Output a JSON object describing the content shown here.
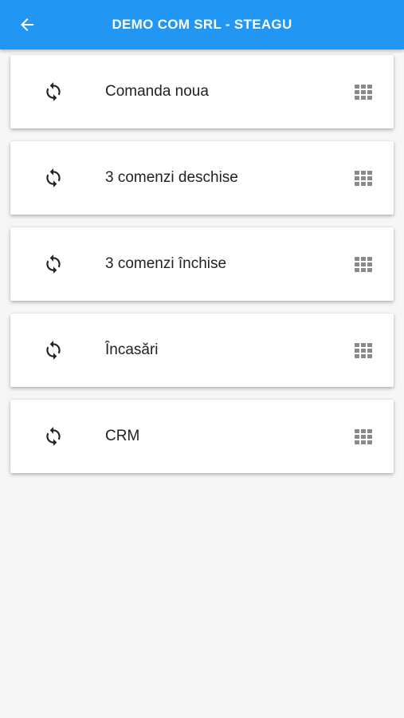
{
  "header": {
    "title": "DEMO COM SRL - STEAGU",
    "back_icon": "arrow-left-icon",
    "background": "#2196f3"
  },
  "menu": {
    "items": [
      {
        "label": "Comanda noua",
        "lead_icon": "sync-icon",
        "trail_icon": "grid-icon"
      },
      {
        "label": "3 comenzi deschise",
        "lead_icon": "sync-icon",
        "trail_icon": "grid-icon"
      },
      {
        "label": "3 comenzi închise",
        "lead_icon": "sync-icon",
        "trail_icon": "grid-icon"
      },
      {
        "label": "Încasări",
        "lead_icon": "sync-icon",
        "trail_icon": "grid-icon"
      },
      {
        "label": "CRM",
        "lead_icon": "sync-icon",
        "trail_icon": "grid-icon"
      }
    ]
  }
}
